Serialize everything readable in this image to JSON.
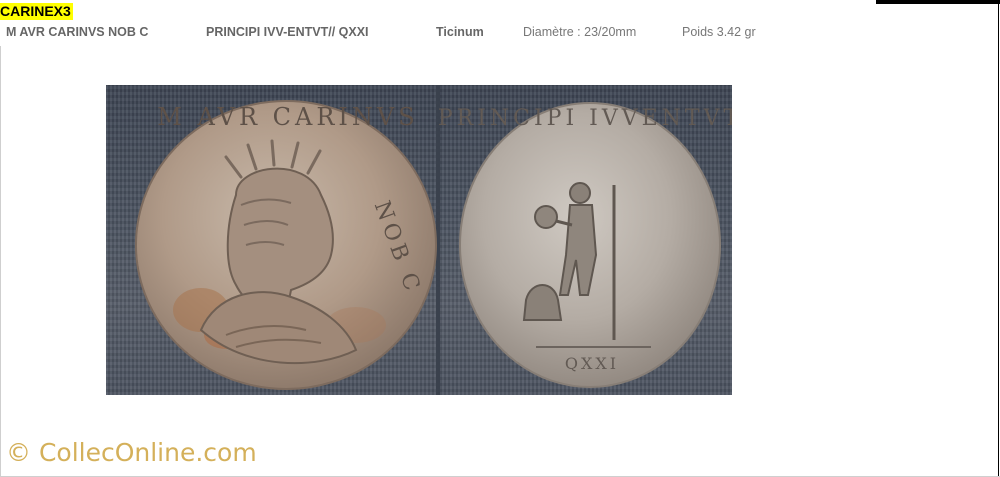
{
  "header": {
    "reference": "CARINEX3",
    "obverse_legend": "M AVR CARINVS NOB C",
    "reverse_legend": "PRINCIPI IVV-ENTVT// QXXI",
    "mint": "Ticinum",
    "diameter": "Diamètre : 23/20mm",
    "weight": "Poids  3.42 gr"
  },
  "photo": {
    "obverse_visible_letters": "M AVR CARINVS NOB C",
    "reverse_visible_letters": "PRINCIPI IVVENTVT",
    "exergue": "QXXI"
  },
  "watermark": "© ColleсOnline.com",
  "colors": {
    "reference_highlight": "#ffff00",
    "watermark": "#d4b05a",
    "background_fabric": "#4a5260"
  }
}
